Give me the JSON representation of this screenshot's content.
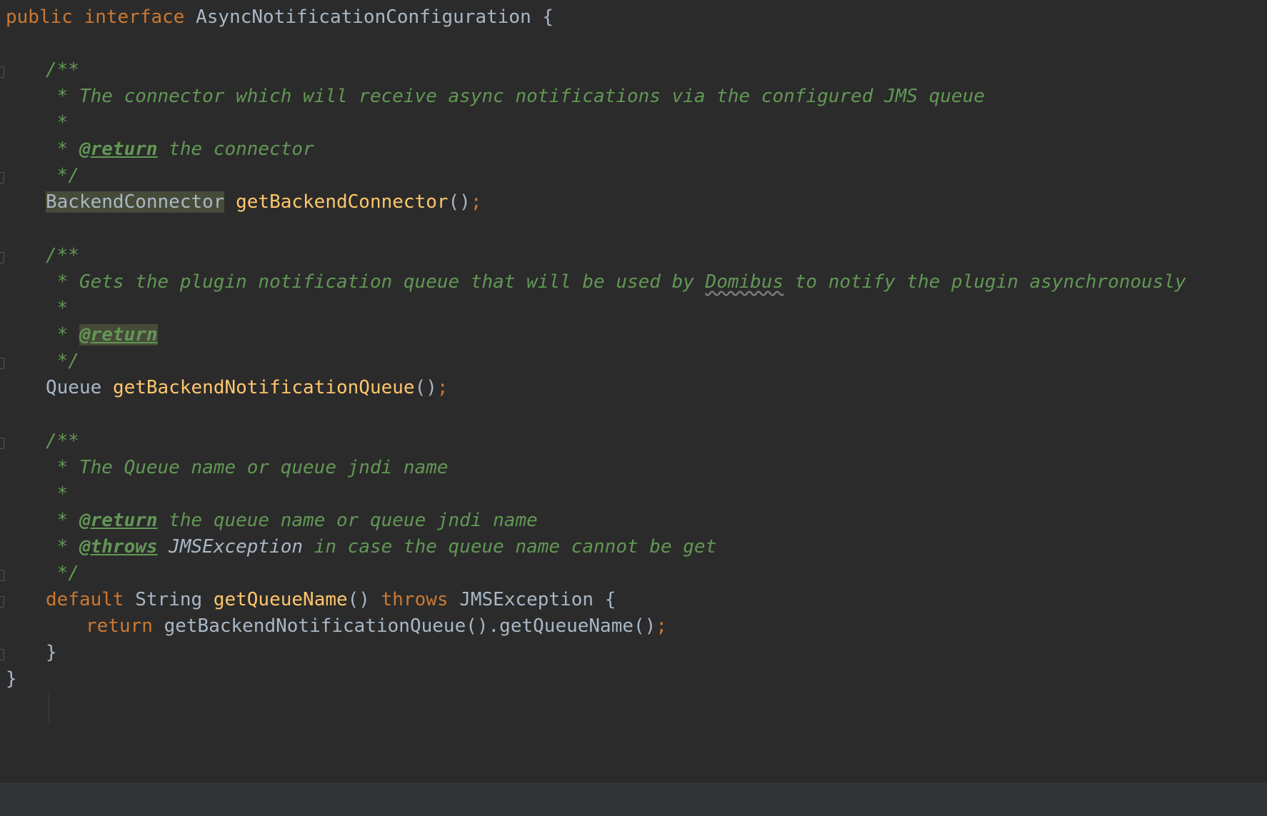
{
  "code": {
    "interface_decl": {
      "kw1": "public",
      "kw2": "interface",
      "name": "AsyncNotificationConfiguration",
      "brace": "{"
    },
    "doc1": {
      "open": "/**",
      "text": " * The connector which will receive async notifications via the configured JMS queue",
      "star": " *",
      "ret_prefix": " * ",
      "ret_tag": "@return",
      "ret_text": " the connector",
      "close": " */"
    },
    "method1": {
      "type": "BackendConnector",
      "name": "getBackendConnector",
      "parens": "()",
      "semi": ";"
    },
    "doc2": {
      "open": "/**",
      "text_a": " * Gets the plugin notification queue that will be used by ",
      "text_word": "Domibus",
      "text_b": " to notify the plugin asynchronously",
      "star": " *",
      "ret_prefix": " * ",
      "ret_tag": "@return",
      "close": " */"
    },
    "method2": {
      "type": "Queue",
      "name": "getBackendNotificationQueue",
      "parens": "()",
      "semi": ";"
    },
    "doc3": {
      "open": "/**",
      "text": " * The Queue name or queue jndi name",
      "star": " *",
      "ret_prefix": " * ",
      "ret_tag": "@return",
      "ret_text": " the queue name or queue jndi name",
      "throws_prefix": " * ",
      "throws_tag": "@throws",
      "throws_ref": " JMSException",
      "throws_text": " in case the queue name cannot be get",
      "close": " */"
    },
    "method3": {
      "kw_default": "default",
      "type": "String",
      "name": "getQueueName",
      "parens": "()",
      "kw_throws": "throws",
      "exc": "JMSException",
      "brace": "{",
      "kw_return": "return",
      "body": "getBackendNotificationQueue().getQueueName()",
      "semi": ";",
      "close": "}"
    },
    "interface_close": "}"
  }
}
